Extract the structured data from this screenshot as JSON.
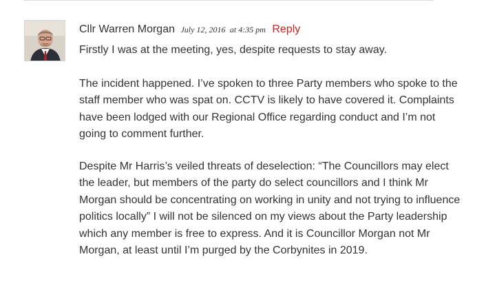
{
  "comment": {
    "author": "Cllr Warren Morgan",
    "date": "July 12, 2016",
    "time": "at 4:35 pm",
    "reply_label": "Reply",
    "paragraphs": [
      "Firstly I was at the meeting, yes, despite requests to stay away.",
      "The incident happened. I’ve spoken to three Party members who spoke to the staff member who was spat on. CCTV is likely to have covered it. Complaints have been lodged with our Regional Office regarding conduct and I’m not going to comment further.",
      "Despite Mr Harris’s veiled threats of deselection: “The Councillors may elect the leader, but members of the party do select councillors and I think Mr Morgan should be concentrating on working in unity and not trying to influence politics locally” I will not be silenced on my views about the Party leadership which any member is free to express. And it is Councillor Morgan not Mr Morgan, at least until I’m purged by the Corbynites in 2019."
    ]
  },
  "colors": {
    "reply_link": "#cc2222",
    "text": "#333333",
    "divider": "#dddddd"
  }
}
